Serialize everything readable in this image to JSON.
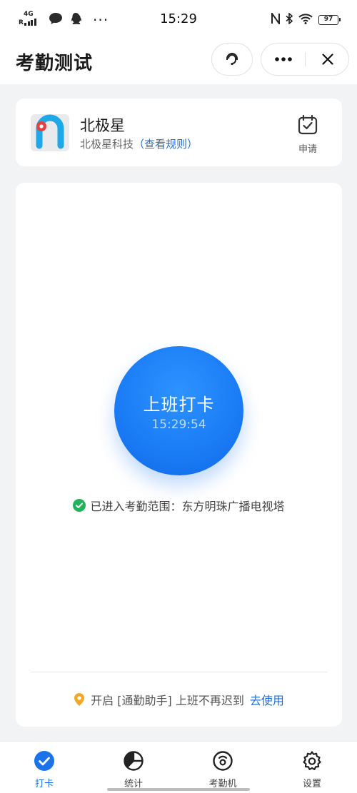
{
  "status_bar": {
    "network": "4G",
    "roaming": "R",
    "more": "···",
    "time": "15:29",
    "battery": "97"
  },
  "header": {
    "title": "考勤测试"
  },
  "company": {
    "name": "北极星",
    "org": "北极星科技",
    "rule_link": "（查看规则）",
    "apply_label": "申请"
  },
  "punch": {
    "label": "上班打卡",
    "time": "15:29:54"
  },
  "range_status": "已进入考勤范围：东方明珠广播电视塔",
  "helper": {
    "text": "开启 [通勤助手] 上班不再迟到",
    "link": "去使用"
  },
  "tabs": [
    {
      "label": "打卡",
      "icon": "punch-check-icon",
      "active": true
    },
    {
      "label": "统计",
      "icon": "pie-chart-icon",
      "active": false
    },
    {
      "label": "考勤机",
      "icon": "attendance-machine-icon",
      "active": false
    },
    {
      "label": "设置",
      "icon": "gear-icon",
      "active": false
    }
  ],
  "colors": {
    "accent": "#1a73e8",
    "link": "#1e6fd9",
    "success": "#21b35a",
    "location": "#f5a623"
  }
}
